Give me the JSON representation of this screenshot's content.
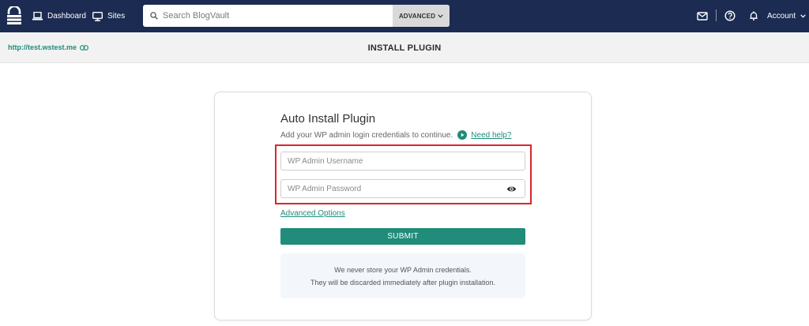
{
  "nav": {
    "dashboard_label": "Dashboard",
    "sites_label": "Sites",
    "search_placeholder": "Search BlogVault",
    "advanced_label": "ADVANCED",
    "account_label": "Account",
    "icons": [
      "logo-icon",
      "dashboard-icon",
      "monitor-icon",
      "search-icon",
      "chevron-down-icon",
      "mail-icon",
      "help-circle-icon",
      "bell-icon"
    ]
  },
  "subheader": {
    "site_url": "http://test.wstest.me",
    "page_title": "INSTALL PLUGIN"
  },
  "form": {
    "title": "Auto Install Plugin",
    "subtitle": "Add your WP admin login credentials to continue.",
    "help_link": "Need help?",
    "username_placeholder": "WP Admin Username",
    "password_placeholder": "WP Admin Password",
    "advanced_options": "Advanced Options",
    "submit_label": "SUBMIT",
    "notice_line1": "We never store your WP Admin credentials.",
    "notice_line2": "They will be discarded immediately after plugin installation."
  },
  "colors": {
    "nav_bg": "#1b2b52",
    "accent": "#208c79",
    "highlight": "#d9262c"
  }
}
